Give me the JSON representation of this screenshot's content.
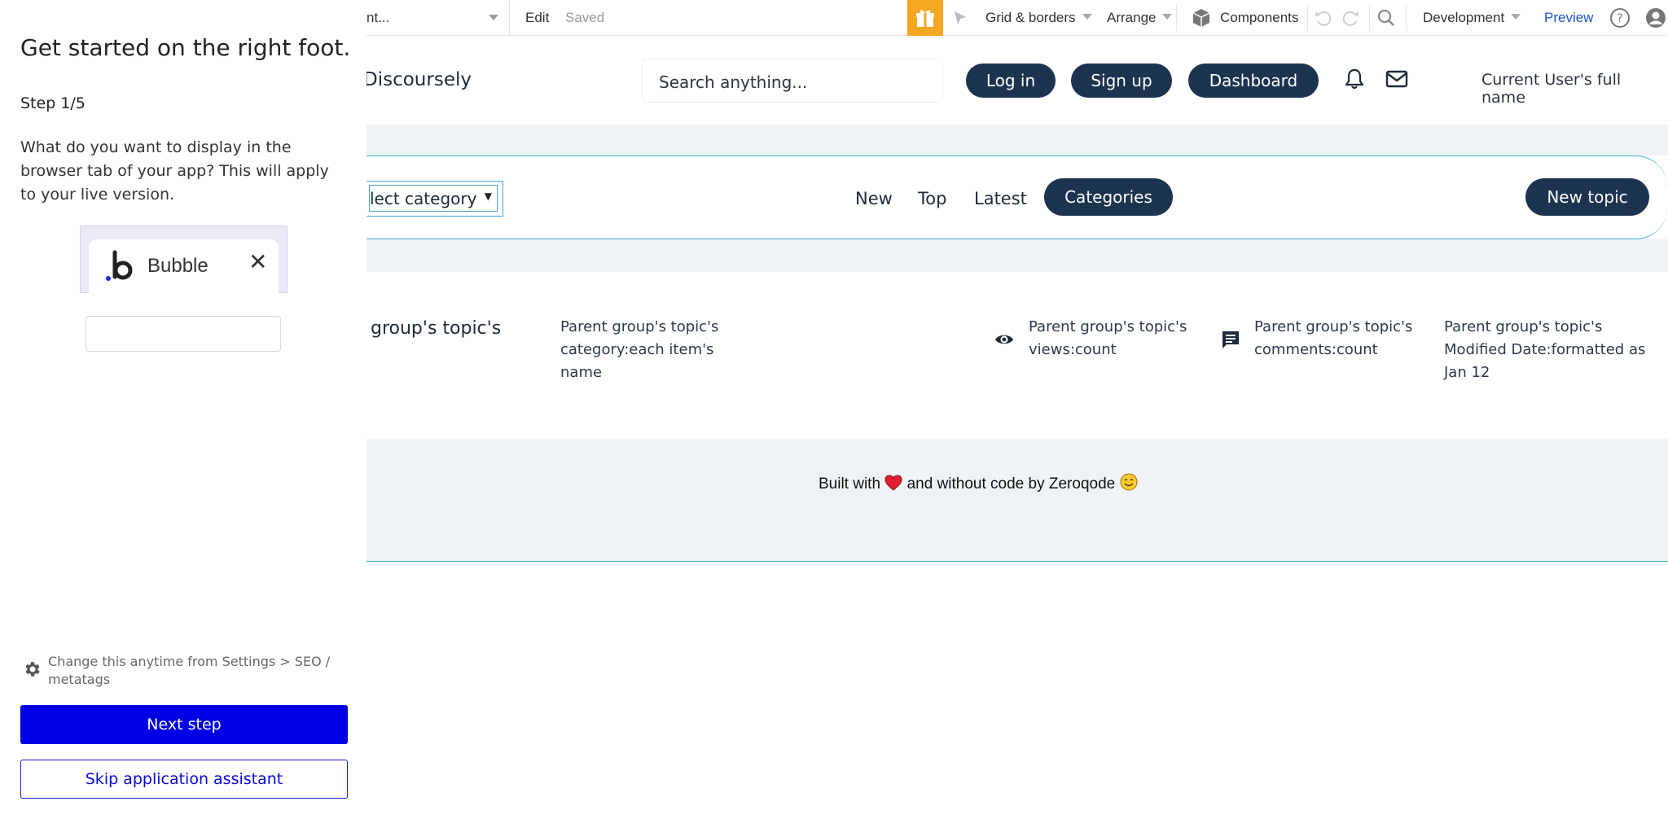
{
  "assistant": {
    "title": "Get started on the right foot.",
    "step": "Step 1/5",
    "question": "What do you want to display in the browser tab of your app? This will apply to your live version.",
    "tab_preview": {
      "name": "Bubble",
      "close": "✕",
      "logo_icon": "bubble-logo-icon"
    },
    "tab_input_value": "",
    "hint": "Change this anytime from Settings > SEO / metatags",
    "next_label": "Next step",
    "skip_label": "Skip application assistant"
  },
  "editor_bar": {
    "page": "nt...",
    "edit": "Edit",
    "saved": "Saved",
    "grid": "Grid & borders",
    "arrange": "Arrange",
    "components": "Components",
    "environment": "Development",
    "preview": "Preview"
  },
  "app": {
    "brand": "Discoursely",
    "search_placeholder": "Search anything...",
    "login": "Log in",
    "signup": "Sign up",
    "dashboard": "Dashboard",
    "user_name": "Current User's full name",
    "category_select": "lect category",
    "nav": {
      "new": "New",
      "top": "Top",
      "latest": "Latest",
      "categories": "Categories"
    },
    "new_topic": "New topic",
    "topic": {
      "title": "group's topic's",
      "category_l1": "Parent group's topic's",
      "category_l2": "category:each item's",
      "category_l3": "name",
      "views_l1": "Parent group's topic's",
      "views_l2": "views:count",
      "comments_l1": "Parent group's topic's",
      "comments_l2": "comments:count",
      "date_l1": "Parent group's topic's",
      "date_l2": "Modified Date:formatted as",
      "date_l3": "Jan 12"
    },
    "footer": {
      "before": "Built with",
      "middle": "and without code by Zeroqode"
    }
  },
  "colors": {
    "navy": "#1d3451",
    "primary_blue": "#0000e6",
    "gift_orange": "#f5a623",
    "canvas_grey": "#eff3f6",
    "accent_line": "#3da7d6"
  }
}
